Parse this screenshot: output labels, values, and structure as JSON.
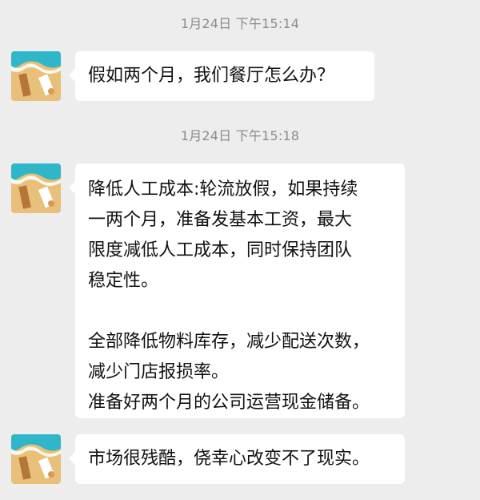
{
  "chat": {
    "messages": [
      {
        "timestamp": "1月24日 下午15:14",
        "text": "假如两个月，我们餐厅怎么办？"
      },
      {
        "timestamp": "1月24日 下午15:18",
        "lines": [
          "降低人工成本:轮流放假，如果持续",
          "一两个月，准备发基本工资，最大",
          "限度减低人工成本，同时保持团队",
          "稳定性。",
          "全部降低物料库存，减少配送次数，",
          "减少门店报损率。",
          "准备好两个月的公司运营现金储备。"
        ]
      },
      {
        "text": "市场很残酷，侥幸心改变不了现实。"
      }
    ]
  },
  "colors": {
    "background": "#ededed",
    "bubble": "#ffffff",
    "timestamp": "#8c8c8c",
    "text": "#111111"
  },
  "icons": {
    "avatar": "beach-avatar-icon"
  }
}
